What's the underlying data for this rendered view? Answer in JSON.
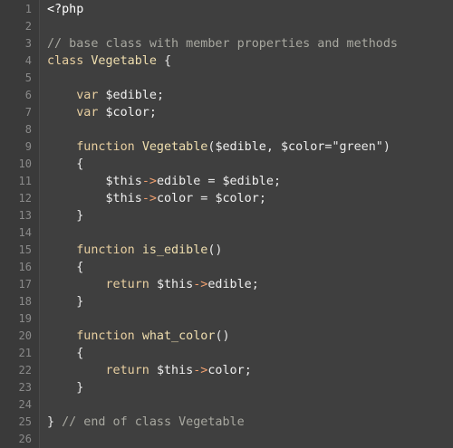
{
  "line_numbers": [
    "1",
    "2",
    "3",
    "4",
    "5",
    "6",
    "7",
    "8",
    "9",
    "10",
    "11",
    "12",
    "13",
    "14",
    "15",
    "16",
    "17",
    "18",
    "19",
    "20",
    "21",
    "22",
    "23",
    "24",
    "25",
    "26"
  ],
  "lines": [
    [
      {
        "t": "<?php",
        "c": "tag"
      }
    ],
    [],
    [
      {
        "t": "// base class with member properties and methods",
        "c": "comment"
      }
    ],
    [
      {
        "t": "class ",
        "c": "keyword"
      },
      {
        "t": "Vegetable",
        "c": "class"
      },
      {
        "t": " {",
        "c": "punct"
      }
    ],
    [],
    [
      {
        "t": "    ",
        "c": "plain"
      },
      {
        "t": "var",
        "c": "keyword"
      },
      {
        "t": " ",
        "c": "plain"
      },
      {
        "t": "$edible",
        "c": "var"
      },
      {
        "t": ";",
        "c": "punct"
      }
    ],
    [
      {
        "t": "    ",
        "c": "plain"
      },
      {
        "t": "var",
        "c": "keyword"
      },
      {
        "t": " ",
        "c": "plain"
      },
      {
        "t": "$color",
        "c": "var"
      },
      {
        "t": ";",
        "c": "punct"
      }
    ],
    [],
    [
      {
        "t": "    ",
        "c": "plain"
      },
      {
        "t": "function",
        "c": "keyword"
      },
      {
        "t": " ",
        "c": "plain"
      },
      {
        "t": "Vegetable",
        "c": "func"
      },
      {
        "t": "(",
        "c": "punct"
      },
      {
        "t": "$edible",
        "c": "var"
      },
      {
        "t": ", ",
        "c": "punct"
      },
      {
        "t": "$color",
        "c": "var"
      },
      {
        "t": "=",
        "c": "punct"
      },
      {
        "t": "\"green\"",
        "c": "string"
      },
      {
        "t": ")",
        "c": "punct"
      }
    ],
    [
      {
        "t": "    {",
        "c": "punct"
      }
    ],
    [
      {
        "t": "        ",
        "c": "plain"
      },
      {
        "t": "$this",
        "c": "var"
      },
      {
        "t": "->",
        "c": "op"
      },
      {
        "t": "edible",
        "c": "var"
      },
      {
        "t": " = ",
        "c": "punct"
      },
      {
        "t": "$edible",
        "c": "var"
      },
      {
        "t": ";",
        "c": "punct"
      }
    ],
    [
      {
        "t": "        ",
        "c": "plain"
      },
      {
        "t": "$this",
        "c": "var"
      },
      {
        "t": "->",
        "c": "op"
      },
      {
        "t": "color",
        "c": "var"
      },
      {
        "t": " = ",
        "c": "punct"
      },
      {
        "t": "$color",
        "c": "var"
      },
      {
        "t": ";",
        "c": "punct"
      }
    ],
    [
      {
        "t": "    }",
        "c": "punct"
      }
    ],
    [],
    [
      {
        "t": "    ",
        "c": "plain"
      },
      {
        "t": "function",
        "c": "keyword"
      },
      {
        "t": " ",
        "c": "plain"
      },
      {
        "t": "is_edible",
        "c": "func"
      },
      {
        "t": "()",
        "c": "punct"
      }
    ],
    [
      {
        "t": "    {",
        "c": "punct"
      }
    ],
    [
      {
        "t": "        ",
        "c": "plain"
      },
      {
        "t": "return",
        "c": "keyword"
      },
      {
        "t": " ",
        "c": "plain"
      },
      {
        "t": "$this",
        "c": "var"
      },
      {
        "t": "->",
        "c": "op"
      },
      {
        "t": "edible",
        "c": "var"
      },
      {
        "t": ";",
        "c": "punct"
      }
    ],
    [
      {
        "t": "    }",
        "c": "punct"
      }
    ],
    [],
    [
      {
        "t": "    ",
        "c": "plain"
      },
      {
        "t": "function",
        "c": "keyword"
      },
      {
        "t": " ",
        "c": "plain"
      },
      {
        "t": "what_color",
        "c": "func"
      },
      {
        "t": "()",
        "c": "punct"
      }
    ],
    [
      {
        "t": "    {",
        "c": "punct"
      }
    ],
    [
      {
        "t": "        ",
        "c": "plain"
      },
      {
        "t": "return",
        "c": "keyword"
      },
      {
        "t": " ",
        "c": "plain"
      },
      {
        "t": "$this",
        "c": "var"
      },
      {
        "t": "->",
        "c": "op"
      },
      {
        "t": "color",
        "c": "var"
      },
      {
        "t": ";",
        "c": "punct"
      }
    ],
    [
      {
        "t": "    }",
        "c": "punct"
      }
    ],
    [],
    [
      {
        "t": "} ",
        "c": "punct"
      },
      {
        "t": "// end of class Vegetable",
        "c": "comment"
      }
    ],
    []
  ],
  "colors": {
    "background": "#3f3f3f",
    "gutter": "#3a3a3a",
    "comment": "#a8a8a0",
    "keyword": "#e8cfa0",
    "operator": "#f0a070"
  }
}
